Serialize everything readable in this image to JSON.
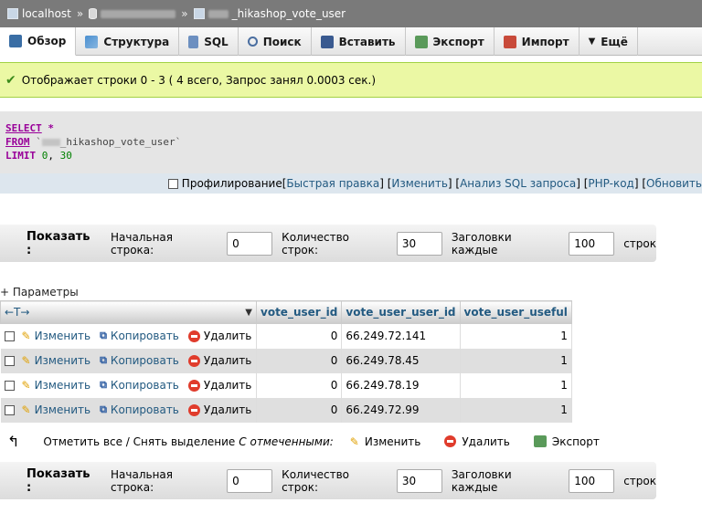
{
  "breadcrumb": {
    "server": "localhost",
    "sep1": "»",
    "sep2": "»",
    "table_suffix": "_hikashop_vote_user"
  },
  "tabs": [
    {
      "label": "Обзор",
      "icon": "browse-icon"
    },
    {
      "label": "Структура",
      "icon": "structure-icon"
    },
    {
      "label": "SQL",
      "icon": "sql-icon"
    },
    {
      "label": "Поиск",
      "icon": "search-icon"
    },
    {
      "label": "Вставить",
      "icon": "insert-icon"
    },
    {
      "label": "Экспорт",
      "icon": "export-icon"
    },
    {
      "label": "Импорт",
      "icon": "import-icon"
    },
    {
      "label": "Ещё",
      "icon": "more-icon"
    }
  ],
  "notice": "Отображает строки 0 - 3 ( 4 всего, Запрос занял 0.0003 сек.)",
  "sql": {
    "select": "SELECT",
    "star": "*",
    "from": "FROM",
    "table": "_hikashop_vote_user",
    "limit": "LIMIT",
    "offset": "0",
    "count": "30"
  },
  "sql_links": {
    "profiling": "Профилирование",
    "quick_edit": "Быстрая правка",
    "edit": "Изменить",
    "analyze": "Анализ SQL запроса",
    "php": "PHP-код",
    "refresh": "Обновить"
  },
  "nav": {
    "show": "Показать :",
    "start_label": "Начальная строка:",
    "start_value": "0",
    "count_label": "Количество строк:",
    "count_value": "30",
    "headers_label": "Заголовки каждые",
    "headers_value": "100",
    "rows_suffix": "строк"
  },
  "params_label": "+ Параметры",
  "table": {
    "resize_arrows": "←T→",
    "columns": [
      "vote_user_id",
      "vote_user_user_id",
      "vote_user_useful"
    ],
    "actions": {
      "edit": "Изменить",
      "copy": "Копировать",
      "delete": "Удалить"
    },
    "rows": [
      {
        "vote_user_id": "0",
        "vote_user_user_id": "66.249.72.141",
        "vote_user_useful": "1"
      },
      {
        "vote_user_id": "0",
        "vote_user_user_id": "66.249.78.45",
        "vote_user_useful": "1"
      },
      {
        "vote_user_id": "0",
        "vote_user_user_id": "66.249.78.19",
        "vote_user_useful": "1"
      },
      {
        "vote_user_id": "0",
        "vote_user_user_id": "66.249.72.99",
        "vote_user_useful": "1"
      }
    ]
  },
  "bulk": {
    "check_all": "Отметить все / Снять выделение",
    "with_selected": "С отмеченными:",
    "edit": "Изменить",
    "delete": "Удалить",
    "export": "Экспорт"
  },
  "colors": {
    "link": "#235a81",
    "notice_bg": "#ebf8a4",
    "keyword": "#990099"
  }
}
